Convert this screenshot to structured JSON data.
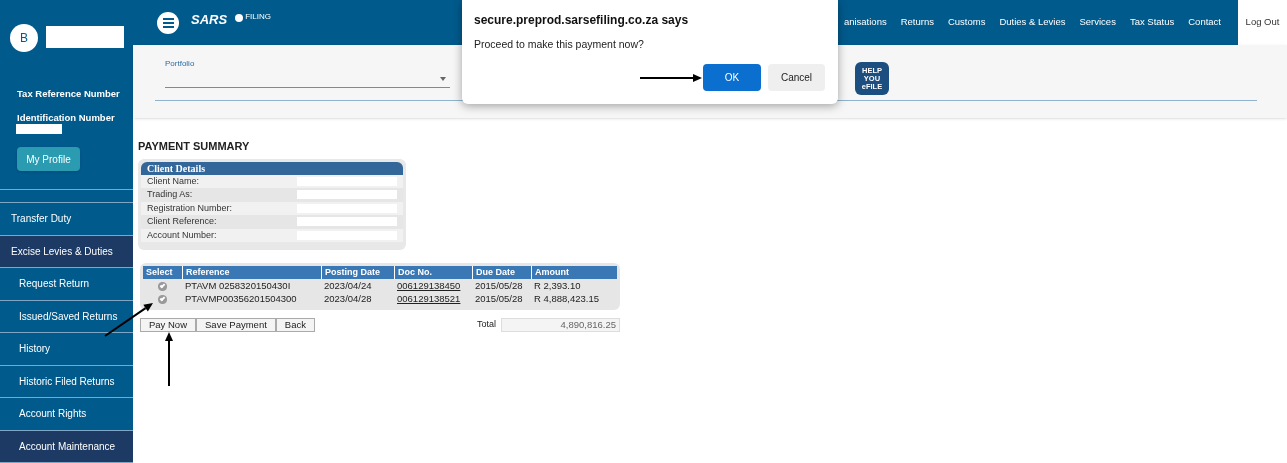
{
  "sidebar": {
    "avatar_letter": "B",
    "labels": [
      "Tax Reference Number",
      "Identification Number"
    ],
    "profile_button": "My Profile",
    "items": [
      {
        "label": "Transfer Duty",
        "selected": false
      },
      {
        "label": "Excise Levies & Duties",
        "selected": true,
        "expanded": true,
        "children": [
          {
            "label": "Request Return",
            "selected": false
          },
          {
            "label": "Issued/Saved Returns",
            "selected": false
          },
          {
            "label": "History",
            "selected": false
          },
          {
            "label": "Historic Filed Returns",
            "selected": false
          },
          {
            "label": "Account Rights",
            "selected": false
          },
          {
            "label": "Account Maintenance",
            "selected": true
          }
        ]
      }
    ]
  },
  "header": {
    "logo_text": "SARS",
    "sub_logo_text": "FILING",
    "nav": [
      {
        "label": "anisations",
        "kind": "link"
      },
      {
        "label": "Returns",
        "kind": "link"
      },
      {
        "label": "Customs",
        "kind": "link"
      },
      {
        "label": "Duties & Levies",
        "kind": "link"
      },
      {
        "label": "Services",
        "kind": "link"
      },
      {
        "label": "Tax Status",
        "kind": "link"
      },
      {
        "label": "Contact",
        "kind": "link"
      },
      {
        "label": "Log Out",
        "kind": "logout"
      }
    ]
  },
  "portfolio": {
    "label": "Portfolio"
  },
  "help_badge": [
    "HELP",
    "YOU",
    "eFILE"
  ],
  "payment_summary": {
    "heading": "PAYMENT SUMMARY",
    "client_details": {
      "title": "Client Details",
      "fields": [
        "Client Name:",
        "Trading As:",
        "Registration Number:",
        "Client Reference:",
        "Account Number:"
      ]
    },
    "table": {
      "columns": [
        "Select",
        "Reference",
        "Posting Date",
        "Doc No.",
        "Due Date",
        "Amount"
      ],
      "rows": [
        {
          "checked": true,
          "reference": "PTAVM 0258320150430I",
          "posting_date": "2023/04/24",
          "doc_no": "006129138450",
          "due_date": "2015/05/28",
          "amount": "R 2,393.10"
        },
        {
          "checked": true,
          "reference": "PTAVMP00356201504300",
          "posting_date": "2023/04/28",
          "doc_no": "006129138521",
          "due_date": "2015/05/28",
          "amount": "R 4,888,423.15"
        }
      ]
    },
    "buttons": [
      "Pay Now",
      "Save Payment",
      "Back"
    ],
    "total_label": "Total",
    "total_value": "4,890,816.25"
  },
  "dialog": {
    "title": "secure.preprod.sarsefiling.co.za says",
    "message": "Proceed to make this payment now?",
    "buttons": [
      {
        "label": "OK",
        "kind": "primary"
      },
      {
        "label": "Cancel",
        "kind": "secondary"
      }
    ]
  }
}
